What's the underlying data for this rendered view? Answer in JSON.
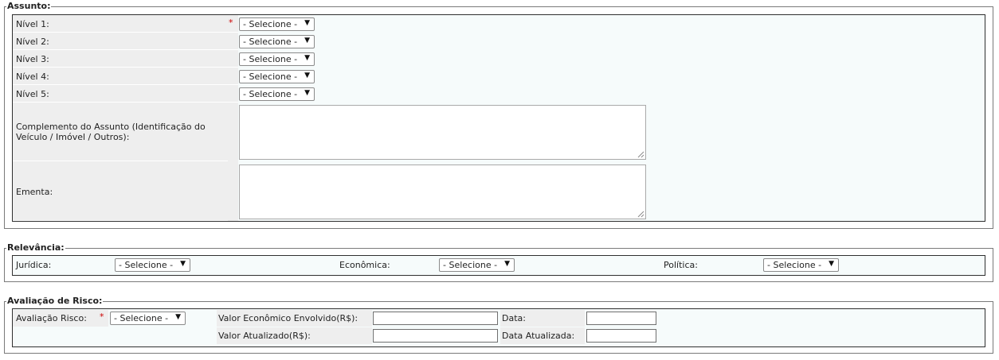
{
  "assunto": {
    "legend": "Assunto:",
    "required_mark": "*",
    "levels": [
      {
        "label": "Nível 1:",
        "value": "- Selecione -"
      },
      {
        "label": "Nível 2:",
        "value": "- Selecione -"
      },
      {
        "label": "Nível 3:",
        "value": "- Selecione -"
      },
      {
        "label": "Nível 4:",
        "value": "- Selecione -"
      },
      {
        "label": "Nível 5:",
        "value": "- Selecione -"
      }
    ],
    "complemento_label": "Complemento do Assunto (Identificação do Veículo / Imóvel / Outros):",
    "complemento_value": "",
    "ementa_label": "Ementa:",
    "ementa_value": ""
  },
  "relevancia": {
    "legend": "Relevância:",
    "juridica_label": "Jurídica:",
    "juridica_value": "- Selecione -",
    "economica_label": "Econômica:",
    "economica_value": "- Selecione -",
    "politica_label": "Política:",
    "politica_value": "- Selecione -"
  },
  "risco": {
    "legend": "Avaliação de Risco:",
    "avaliacao_label": "Avaliação Risco:",
    "required_mark": "*",
    "avaliacao_value": "- Selecione -",
    "valor_economico_label": "Valor Econômico Envolvido(R$):",
    "valor_economico_value": "",
    "data_label": "Data:",
    "data_value": "",
    "valor_atualizado_label": "Valor Atualizado(R$):",
    "valor_atualizado_value": "",
    "data_atualizada_label": "Data Atualizada:",
    "data_atualizada_value": ""
  },
  "icons": {
    "caret": "▼"
  }
}
